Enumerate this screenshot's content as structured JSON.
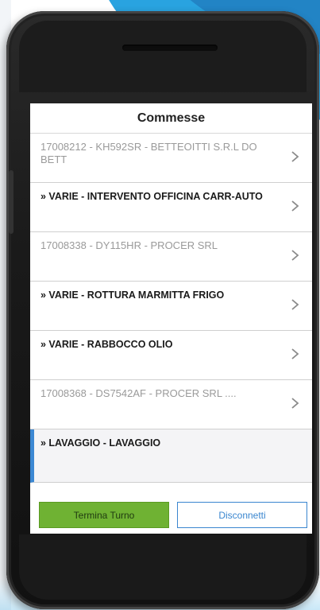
{
  "dialog": {
    "title": "Commesse"
  },
  "list": {
    "items": [
      {
        "label": "17008212 - KH592SR - BETTEOITTI S.R.L DO BETT",
        "style": "normal"
      },
      {
        "label": "» VARIE - INTERVENTO OFFICINA CARR-AUTO",
        "style": "bold"
      },
      {
        "label": "17008338 - DY115HR - PROCER SRL",
        "style": "normal"
      },
      {
        "label": "» VARIE - ROTTURA MARMITTA FRIGO",
        "style": "bold"
      },
      {
        "label": "» VARIE - RABBOCCO OLIO",
        "style": "bold"
      },
      {
        "label": "17008368 - DS7542AF - PROCER SRL ....",
        "style": "normal"
      },
      {
        "label": "» LAVAGGIO - LAVAGGIO",
        "style": "bold-active"
      }
    ]
  },
  "footer": {
    "primary_label": "Termina Turno",
    "secondary_label": "Disconnetti"
  },
  "colors": {
    "primary_button": "#6fb233",
    "secondary_button_border": "#3a86cf",
    "active_indicator": "#3c88d3",
    "background_accent": "#29a3e0"
  },
  "icons": {
    "row_chevron": "chevron-right-icon"
  }
}
